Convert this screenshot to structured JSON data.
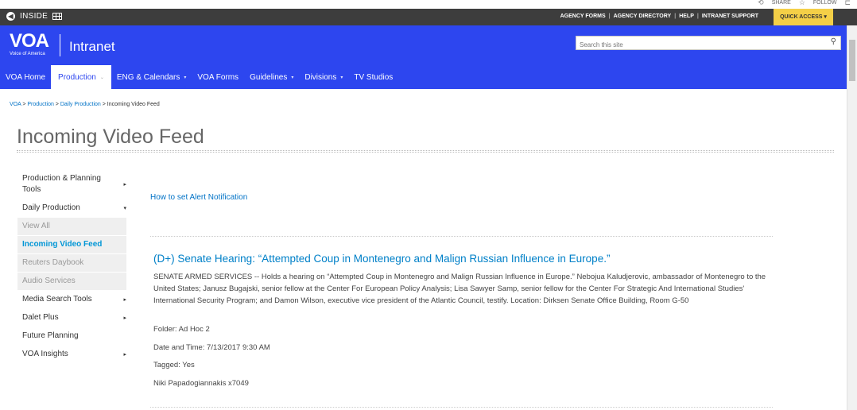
{
  "topstrip": {
    "share": "SHARE",
    "follow": "FOLLOW"
  },
  "insidebar": {
    "label": "INSIDE",
    "links": [
      "AGENCY FORMS",
      "AGENCY DIRECTORY",
      "HELP",
      "INTRANET SUPPORT"
    ],
    "quick_access": "QUICK ACCESS ▾"
  },
  "header": {
    "logo_mark": "VOA",
    "logo_sub": "Voice of America",
    "site_title": "Intranet",
    "search_placeholder": "Search this site"
  },
  "nav": {
    "items": [
      {
        "label": "VOA Home",
        "caret": ""
      },
      {
        "label": "Production",
        "caret": "⌄"
      },
      {
        "label": "ENG & Calendars",
        "caret": "▾"
      },
      {
        "label": "VOA Forms",
        "caret": ""
      },
      {
        "label": "Guidelines",
        "caret": "▾"
      },
      {
        "label": "Divisions",
        "caret": "▾"
      },
      {
        "label": "TV Studios",
        "caret": ""
      }
    ]
  },
  "breadcrumb": {
    "items": [
      "VOA",
      "Production",
      "Daily Production"
    ],
    "current": "Incoming Video Feed",
    "sep": " > "
  },
  "page": {
    "title": "Incoming Video Feed"
  },
  "leftnav": {
    "items": [
      {
        "label": "Production & Planning Tools",
        "arrow": "▸"
      },
      {
        "label": "Daily Production",
        "arrow": "▾"
      },
      {
        "label": "View All",
        "arrow": ""
      },
      {
        "label": "Incoming Video Feed",
        "arrow": ""
      },
      {
        "label": "Reuters Daybook",
        "arrow": ""
      },
      {
        "label": "Audio Services",
        "arrow": ""
      },
      {
        "label": "Media Search Tools",
        "arrow": "▸"
      },
      {
        "label": "Dalet Plus",
        "arrow": "▸"
      },
      {
        "label": "Future Planning",
        "arrow": ""
      },
      {
        "label": "VOA Insights",
        "arrow": "▸"
      }
    ]
  },
  "main": {
    "alert_link": "How to set Alert Notification",
    "item": {
      "title": "(D+) Senate Hearing: “Attempted Coup in Montenegro and Malign Russian Influence in Europe.”",
      "description": "SENATE ARMED SERVICES -- Holds a hearing on “Attempted Coup in Montenegro and Malign Russian Influence in Europe.” Nebojua Kaludjerovic, ambassador of Montenegro to the United States; Janusz Bugajski, senior fellow at the Center For European Policy Analysis; Lisa Sawyer Samp, senior fellow for the Center For Strategic And International Studies' International Security Program; and Damon Wilson, executive vice president of the Atlantic Council, testify. Location: Dirksen Senate Office Building, Room G-50",
      "folder": "Folder: Ad Hoc 2",
      "datetime": "Date and Time: 7/13/2017 9:30 AM",
      "tagged": "Tagged: Yes",
      "contact": "Niki Papadogiannakis x7049"
    }
  }
}
